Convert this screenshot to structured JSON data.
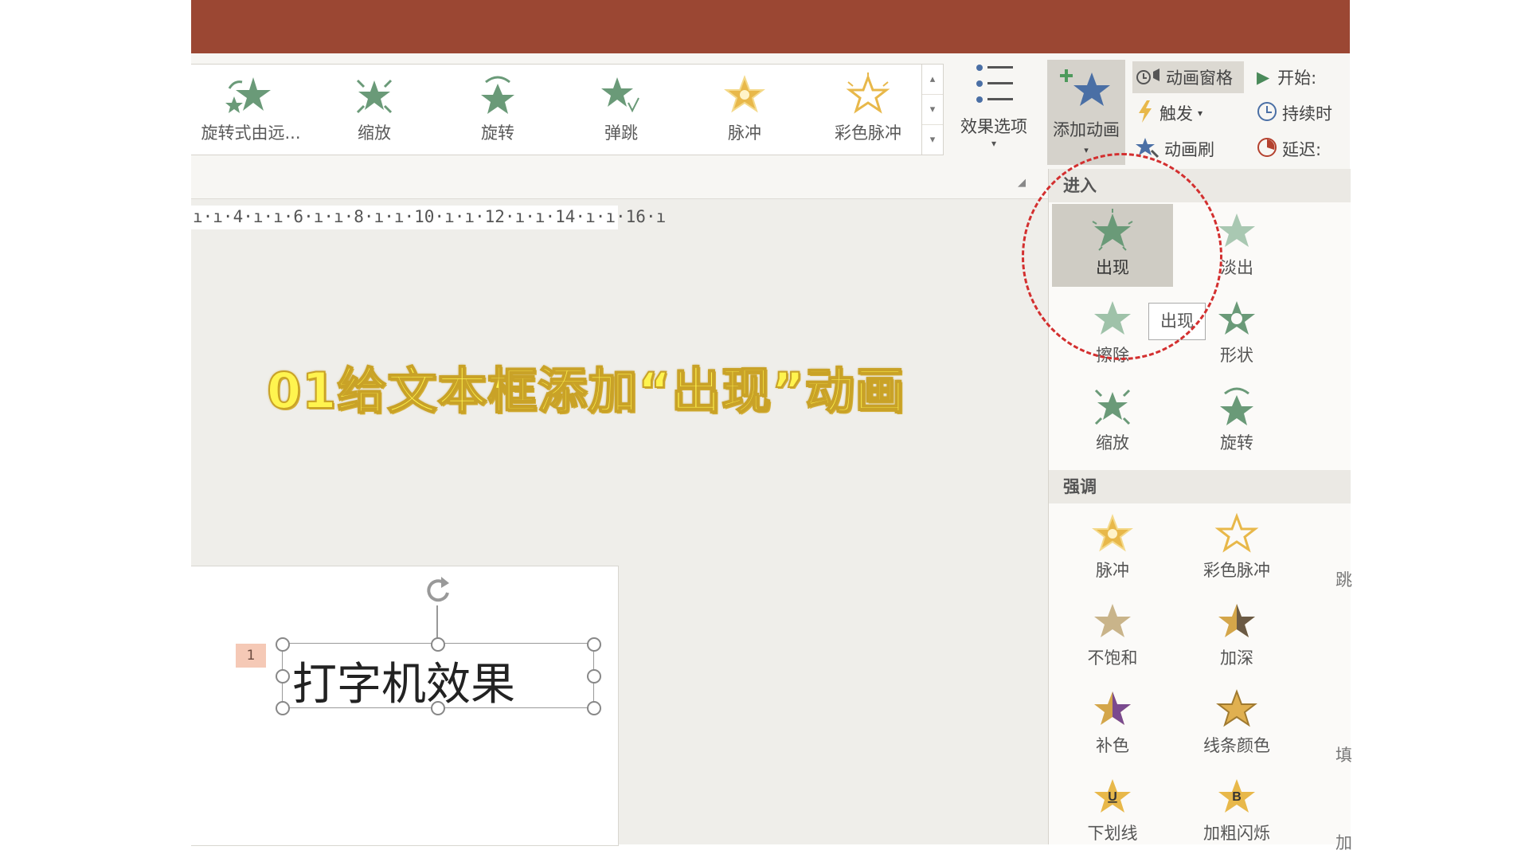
{
  "window": {
    "titlebar_color": "#9b4733"
  },
  "ribbon": {
    "gallery_items": [
      {
        "label": "旋转式由远...",
        "icon": "spin-in-star-icon"
      },
      {
        "label": "缩放",
        "icon": "zoom-star-icon"
      },
      {
        "label": "旋转",
        "icon": "rotate-star-icon"
      },
      {
        "label": "弹跳",
        "icon": "bounce-star-icon"
      },
      {
        "label": "脉冲",
        "icon": "pulse-star-icon"
      },
      {
        "label": "彩色脉冲",
        "icon": "color-pulse-star-icon"
      }
    ],
    "effect_options": {
      "label": "效果选项"
    },
    "add_animation": {
      "label": "添加动画"
    },
    "animation_pane": {
      "label": "动画窗格"
    },
    "trigger": {
      "label": "触发"
    },
    "animation_painter": {
      "label": "动画刷"
    },
    "timing": {
      "start": "开始:",
      "duration": "持续时",
      "delay": "延迟:"
    }
  },
  "ruler": {
    "text": "ı·ı·4·ı·ı·6·ı·ı·8·ı·ı·10·ı·ı·12·ı·ı·14·ı·ı·16·ı"
  },
  "overlay": {
    "text": "01给文本框添加“出现”动画"
  },
  "slide": {
    "animation_number": "1",
    "textbox_text": "打字机效果"
  },
  "dropdown": {
    "sections": [
      {
        "title": "进入",
        "items": [
          {
            "label": "出现",
            "selected": true
          },
          {
            "label": "淡出"
          },
          {
            "label": "擦除"
          },
          {
            "label": "形状"
          },
          {
            "label": "缩放"
          },
          {
            "label": "旋转"
          }
        ]
      },
      {
        "title": "强调",
        "items": [
          {
            "label": "脉冲"
          },
          {
            "label": "彩色脉冲"
          },
          {
            "label": "不饱和"
          },
          {
            "label": "加深"
          },
          {
            "label": "补色"
          },
          {
            "label": "线条颜色"
          },
          {
            "label": "下划线"
          },
          {
            "label": "加粗闪烁"
          }
        ],
        "edge_labels": [
          "跳",
          "填",
          "加"
        ]
      }
    ],
    "tooltip": "出现"
  },
  "colors": {
    "accent_green": "#6a9a78",
    "gold": "#e8b84a",
    "highlight_red": "#d32f2f"
  }
}
